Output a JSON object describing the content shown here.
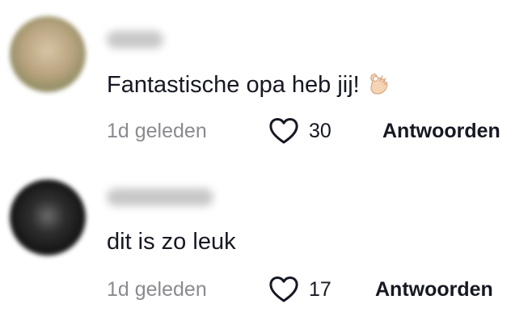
{
  "comments": [
    {
      "text": "Fantastische opa heb jij!",
      "emoji_icon": "ok-hand-icon",
      "timestamp": "1d geleden",
      "like_count": "30",
      "reply_label": "Antwoorden"
    },
    {
      "text": "dit is zo leuk",
      "timestamp": "1d geleden",
      "like_count": "17",
      "reply_label": "Antwoorden"
    }
  ],
  "colors": {
    "text_primary": "#161823",
    "text_secondary": "#8a8b91",
    "background": "#ffffff"
  }
}
